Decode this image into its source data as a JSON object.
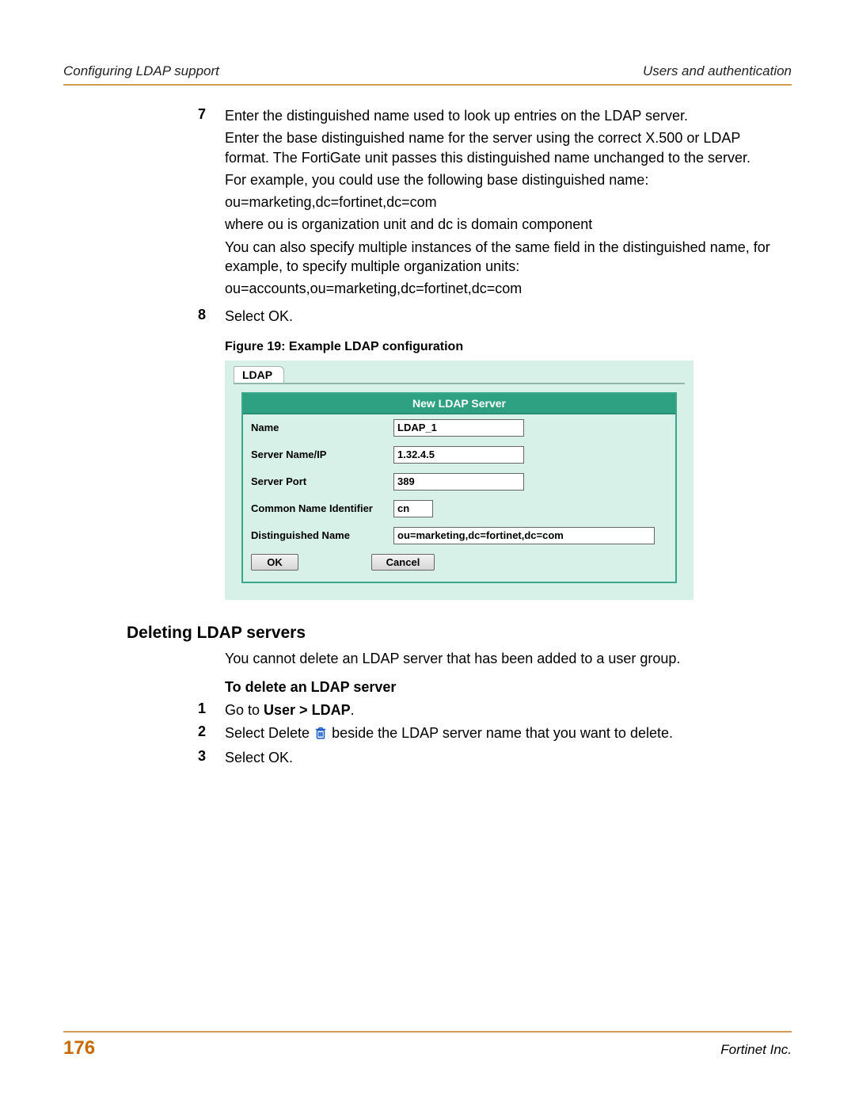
{
  "header": {
    "left": "Configuring LDAP support",
    "right": "Users and authentication"
  },
  "steps7": {
    "num": "7",
    "p1": "Enter the distinguished name used to look up entries on the LDAP server.",
    "p2": "Enter the base distinguished name for the server using the correct X.500 or LDAP format. The FortiGate unit passes this distinguished name unchanged to the server.",
    "p3": "For example, you could use the following base distinguished name:",
    "p4": "ou=marketing,dc=fortinet,dc=com",
    "p5": "where ou is organization unit and dc is domain component",
    "p6": "You can also specify multiple instances of the same field in the distinguished name, for example, to specify multiple organization units:",
    "p7": "ou=accounts,ou=marketing,dc=fortinet,dc=com"
  },
  "steps8": {
    "num": "8",
    "p1": "Select OK."
  },
  "figure_caption": "Figure 19: Example LDAP configuration",
  "ldap_form": {
    "tab": "LDAP",
    "title": "New LDAP Server",
    "rows": {
      "name_label": "Name",
      "name_value": "LDAP_1",
      "server_label": "Server Name/IP",
      "server_value": "1.32.4.5",
      "port_label": "Server Port",
      "port_value": "389",
      "cn_label": "Common Name Identifier",
      "cn_value": "cn",
      "dn_label": "Distinguished Name",
      "dn_value": "ou=marketing,dc=fortinet,dc=com"
    },
    "ok": "OK",
    "cancel": "Cancel"
  },
  "section_heading": "Deleting LDAP servers",
  "del_para": "You cannot delete an LDAP server that has been added to a user group.",
  "del_sub": "To delete an LDAP server",
  "del_steps": {
    "s1num": "1",
    "s1a": "Go to ",
    "s1b": "User > LDAP",
    "s1c": ".",
    "s2num": "2",
    "s2a": "Select Delete ",
    "s2b": " beside the LDAP server name that you want to delete.",
    "s3num": "3",
    "s3": "Select OK."
  },
  "footer": {
    "page": "176",
    "right": "Fortinet Inc."
  }
}
